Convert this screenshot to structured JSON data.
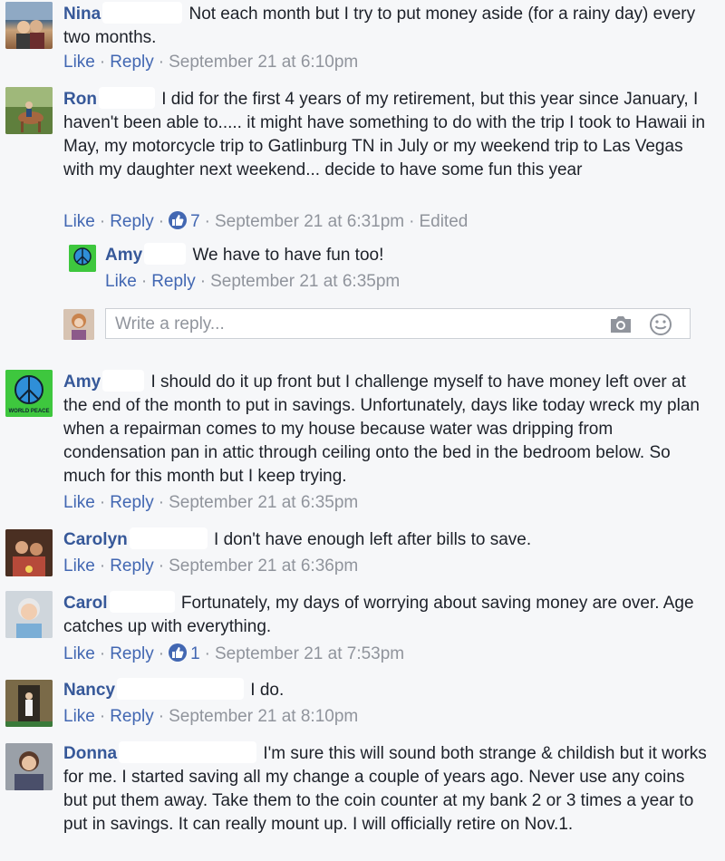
{
  "comments": [
    {
      "name": "Nina",
      "text": " Not each month but I try to put money aside (for a rainy day) every two months.",
      "like": "Like",
      "reply": "Reply",
      "time": "September 21 at 6:10pm"
    },
    {
      "name": "Ron",
      "text": " I did for the first 4 years of my retirement, but this year since January, I haven't been able to..... it might have something to do with the trip I took to Hawaii in May, my motorcycle trip to Gatlinburg TN in July or my weekend trip to Las Vegas with my daughter next weekend... decide to have some fun this year",
      "like": "Like",
      "reply": "Reply",
      "reactions": "7",
      "time": "September 21 at 6:31pm",
      "edited": "Edited",
      "replies": [
        {
          "name": "Amy",
          "text": " We have to have fun too!",
          "like": "Like",
          "reply": "Reply",
          "time": "September 21 at 6:35pm"
        }
      ],
      "reply_box": {
        "placeholder": "Write a reply..."
      }
    },
    {
      "name": "Amy",
      "text": " I should do it up front but I challenge myself to have money left over at the end of the month to put in savings. Unfortunately, days like today wreck my plan when a repairman comes to my house because water was dripping from condensation pan in attic through ceiling onto the bed in the bedroom below. So much for this month but I keep trying.",
      "like": "Like",
      "reply": "Reply",
      "time": "September 21 at 6:35pm"
    },
    {
      "name": "Carolyn",
      "text": " I don't have enough left after bills to save.",
      "like": "Like",
      "reply": "Reply",
      "time": "September 21 at 6:36pm"
    },
    {
      "name": "Carol",
      "text": " Fortunately, my days of worrying about saving money are over. Age catches up with everything.",
      "like": "Like",
      "reply": "Reply",
      "reactions": "1",
      "time": "September 21 at 7:53pm"
    },
    {
      "name": "Nancy",
      "text": " I do.",
      "like": "Like",
      "reply": "Reply",
      "time": "September 21 at 8:10pm"
    },
    {
      "name": "Donna",
      "text": " I'm sure this will sound both strange & childish but it works for me. I started saving all my change a couple of years ago. Never use any coins but put them away. Take them to the coin counter at my bank 2 or 3 times a year to put in savings. It can really mount up. I will officially retire on Nov.1."
    }
  ],
  "colors": {
    "name": "#365899",
    "link": "#4267b2",
    "meta": "#90949c",
    "background": "#f6f7f9"
  },
  "world_peace_logo_text": "WORLD PEACE"
}
